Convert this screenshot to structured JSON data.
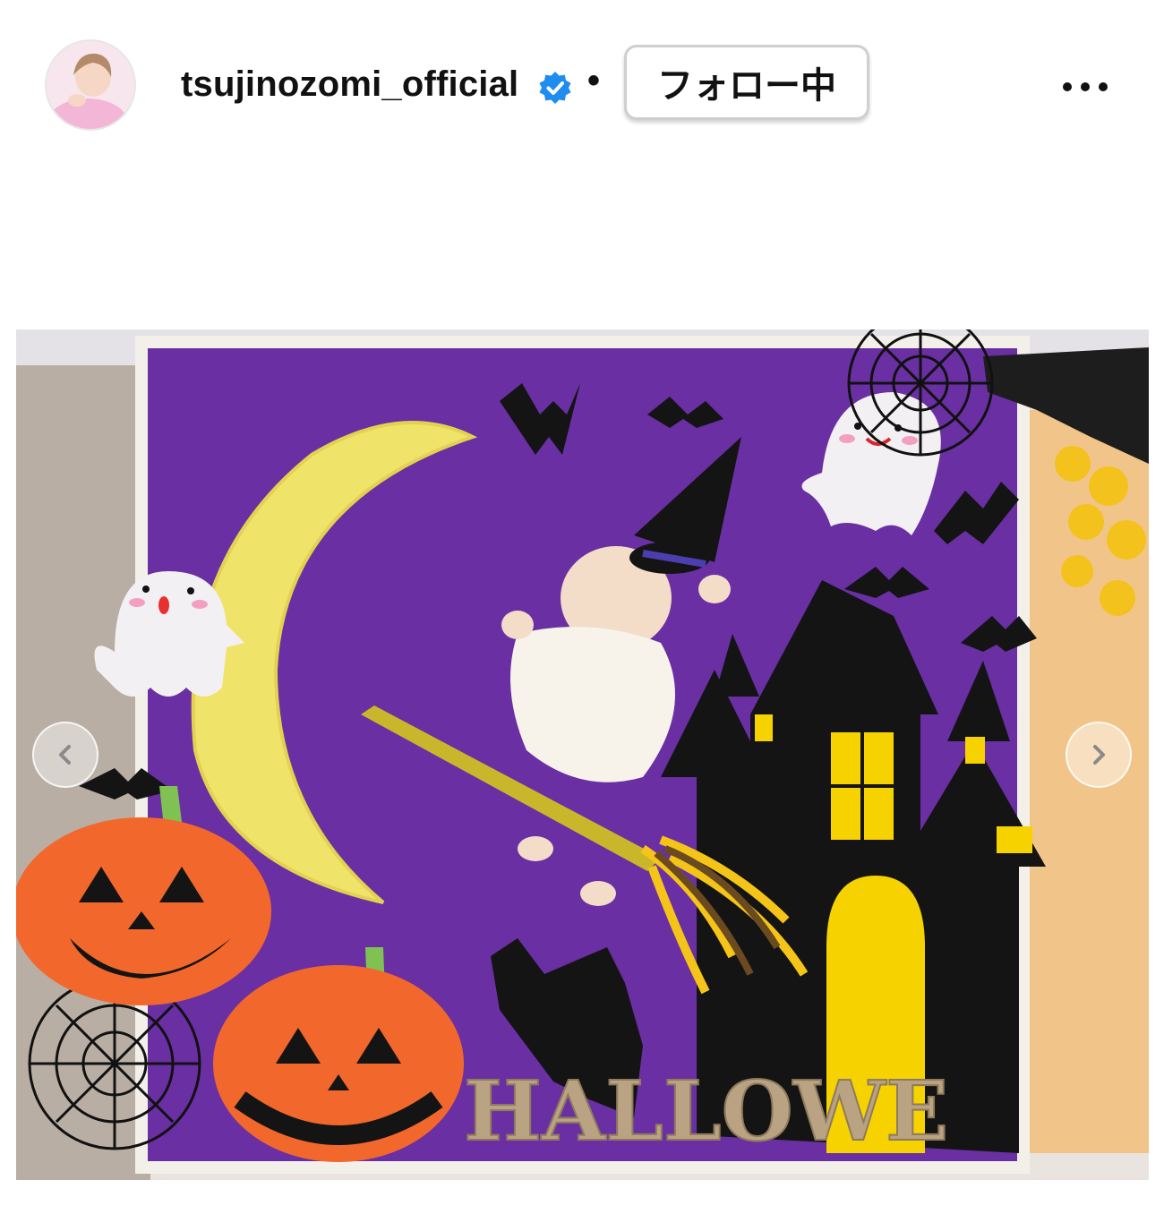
{
  "post_header": {
    "username": "tsujinozomi_official",
    "verified": true,
    "separator": "•",
    "follow_label": "フォロー中",
    "more_icon": "more-horizontal-icon"
  },
  "photo": {
    "banner_text": "HALLOWE",
    "colors": {
      "backdrop": "#6a2fa3",
      "moon": "#f0e36a",
      "pumpkin": "#f2682c",
      "castle": "#141414",
      "window": "#f5d200"
    }
  },
  "carousel": {
    "prev_icon": "chevron-left-icon",
    "next_icon": "chevron-right-icon"
  }
}
